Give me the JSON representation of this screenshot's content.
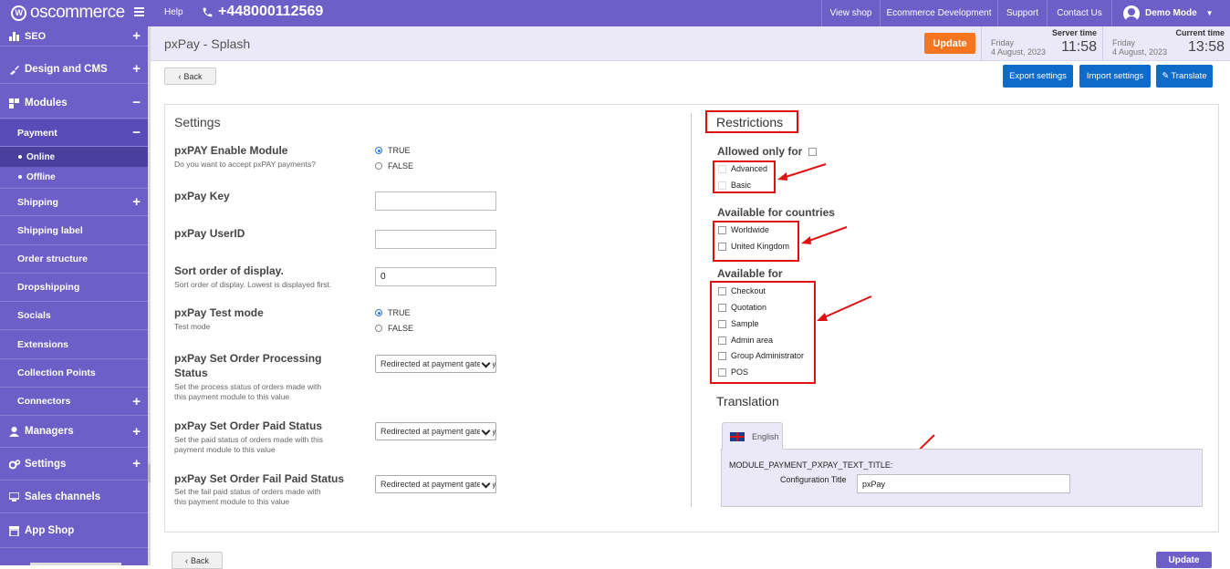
{
  "topbar": {
    "logo_text": "oscommerce",
    "logo_badge": "W",
    "help": "Help",
    "phone": "+448000112569",
    "nav": [
      "View shop",
      "Ecommerce Development",
      "Support",
      "Contact Us"
    ],
    "user": "Demo Mode"
  },
  "sidebar": {
    "items": [
      {
        "label": "SEO",
        "icon": "seo-icon",
        "toggle": "+"
      },
      {
        "label": "Design and CMS",
        "icon": "brush-icon",
        "toggle": "+"
      },
      {
        "label": "Modules",
        "icon": "modules-icon",
        "toggle": "−"
      },
      {
        "label": "Payment",
        "toggle": "−"
      },
      {
        "label": "Online"
      },
      {
        "label": "Offline"
      },
      {
        "label": "Shipping",
        "toggle": "+"
      },
      {
        "label": "Shipping label"
      },
      {
        "label": "Order structure"
      },
      {
        "label": "Dropshipping"
      },
      {
        "label": "Socials"
      },
      {
        "label": "Extensions"
      },
      {
        "label": "Collection Points"
      },
      {
        "label": "Connectors",
        "toggle": "+"
      },
      {
        "label": "Managers",
        "icon": "user-icon",
        "toggle": "+"
      },
      {
        "label": "Settings",
        "icon": "gears-icon",
        "toggle": "+"
      },
      {
        "label": "Sales channels",
        "icon": "monitor-icon"
      },
      {
        "label": "App Shop",
        "icon": "shop-icon"
      }
    ]
  },
  "header": {
    "title": "pxPay - Splash",
    "update": "Update",
    "server_time": {
      "label": "Server time",
      "day": "Friday",
      "date": "4 August, 2023",
      "time": "11:58"
    },
    "current_time": {
      "label": "Current time",
      "day": "Friday",
      "date": "4 August, 2023",
      "time": "13:58"
    }
  },
  "toolbar": {
    "back": "Back",
    "export": "Export settings",
    "import": "Import settings",
    "translate": "Translate"
  },
  "settings": {
    "heading": "Settings",
    "enable": {
      "label": "pxPAY Enable Module",
      "desc": "Do you want to accept pxPAY payments?",
      "opt1": "TRUE",
      "opt2": "FALSE"
    },
    "key": {
      "label": "pxPay Key",
      "value": ""
    },
    "userid": {
      "label": "pxPay UserID",
      "value": ""
    },
    "sort": {
      "label": "Sort order of display.",
      "desc": "Sort order of display. Lowest is displayed first.",
      "value": "0"
    },
    "test": {
      "label": "pxPay Test mode",
      "desc": "Test mode",
      "opt1": "TRUE",
      "opt2": "FALSE"
    },
    "processing": {
      "label1": "pxPay Set Order Processing",
      "label2": "Status",
      "desc1": "Set the process status of orders made with",
      "desc2": "this payment module to this value",
      "value": "Redirected at payment gateway"
    },
    "paid": {
      "label": "pxPay Set Order Paid Status",
      "desc1": "Set the paid status of orders made with this",
      "desc2": "payment module to this value",
      "value": "Redirected at payment gateway"
    },
    "failpaid": {
      "label": "pxPay Set Order Fail Paid Status",
      "desc1": "Set the fail paid status of orders made with",
      "desc2": "this payment module to this value",
      "value": "Redirected at payment gateway"
    }
  },
  "restrictions": {
    "heading": "Restrictions",
    "allowed_heading": "Allowed only for",
    "allowed": [
      "Advanced",
      "Basic"
    ],
    "countries_heading": "Available for countries",
    "countries": [
      "Worldwide",
      "United Kingdom"
    ],
    "available_heading": "Available for",
    "available": [
      "Checkout",
      "Quotation",
      "Sample",
      "Admin area",
      "Group Administrator",
      "POS"
    ]
  },
  "translation": {
    "heading": "Translation",
    "tab": "English",
    "key": "MODULE_PAYMENT_PXPAY_TEXT_TITLE:",
    "field_label": "Configuration Title",
    "field_value": "pxPay"
  },
  "footer": {
    "back": "Back",
    "update": "Update"
  },
  "colors": {
    "accent": "#6e5fc8",
    "update": "#f7751e",
    "blue": "#0e6bc9",
    "highlight": "#dd1111"
  }
}
